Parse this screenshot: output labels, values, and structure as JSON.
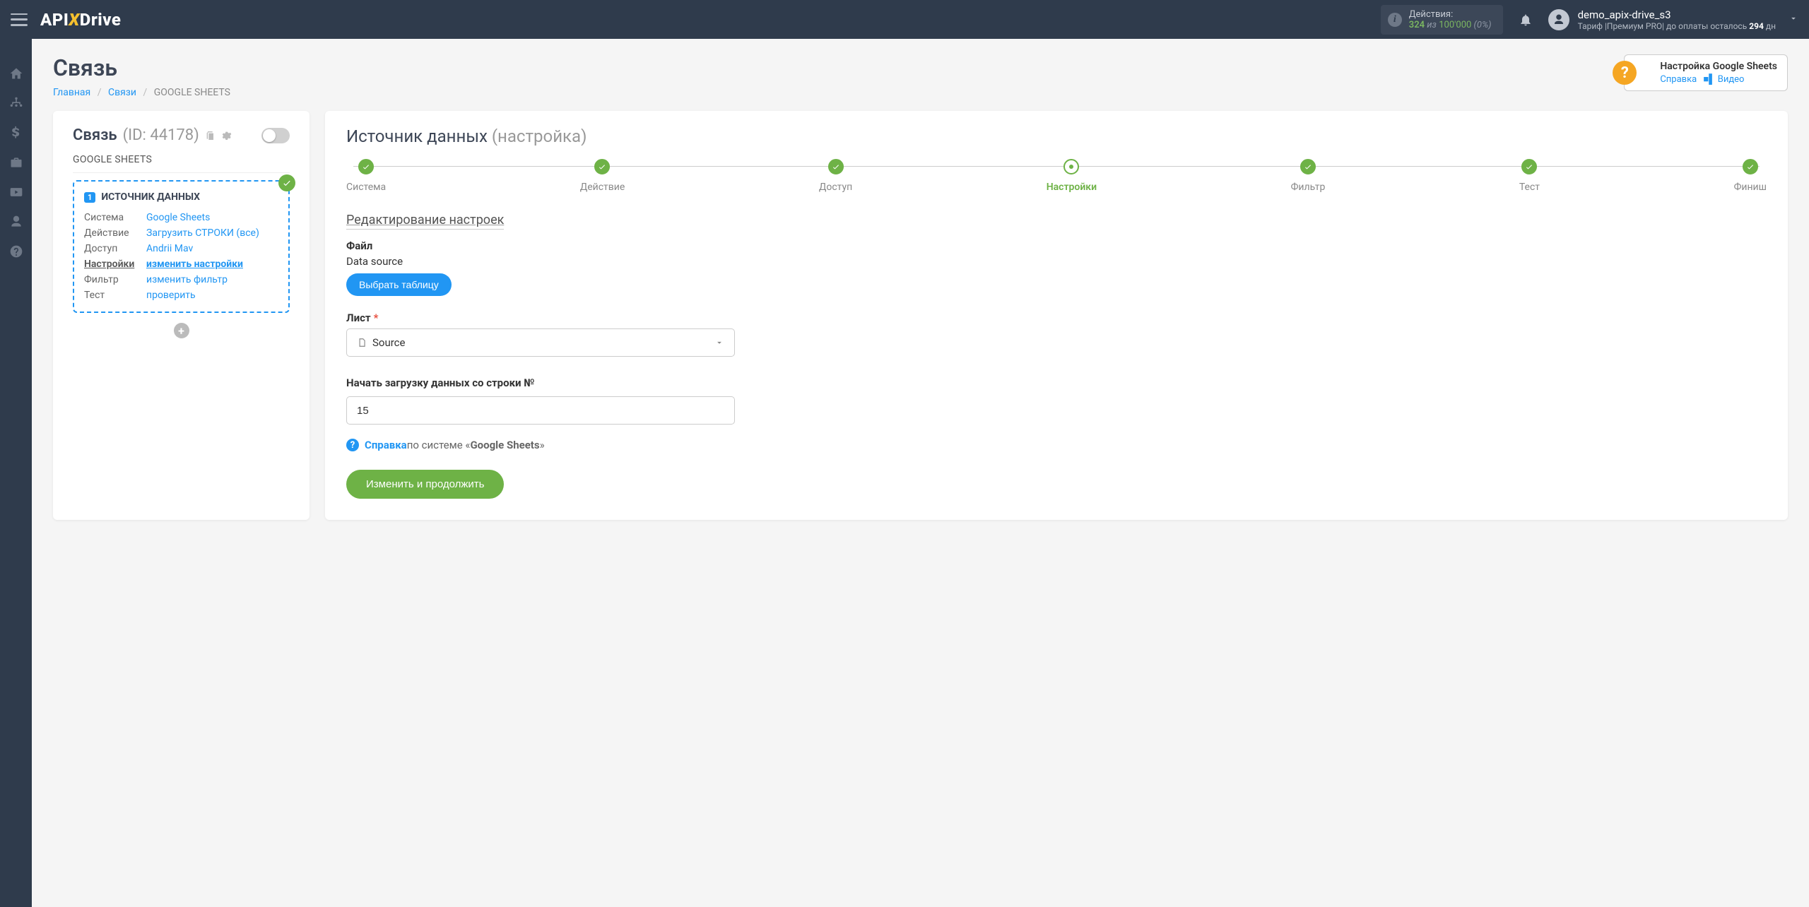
{
  "topbar": {
    "actions_label": "Действия:",
    "actions_count": "324",
    "actions_iz": "из",
    "actions_max": "100'000",
    "actions_pct": "(0%)",
    "username": "demo_apix-drive_s3",
    "tariff_prefix": "Тариф |Премиум PRO| до оплаты осталось ",
    "tariff_days": "294",
    "tariff_suffix": " дн"
  },
  "page": {
    "title": "Связь",
    "breadcrumb_home": "Главная",
    "breadcrumb_links": "Связи",
    "breadcrumb_current": "GOOGLE SHEETS"
  },
  "helpbox": {
    "title": "Настройка Google Sheets",
    "link_help": "Справка",
    "link_video": "Видео"
  },
  "leftcard": {
    "title": "Связь",
    "id": "(ID: 44178)",
    "subtitle": "GOOGLE SHEETS",
    "source_header": "ИСТОЧНИК ДАННЫХ",
    "rows": {
      "system_label": "Система",
      "system_value": "Google Sheets",
      "action_label": "Действие",
      "action_value": "Загрузить СТРОКИ (все)",
      "access_label": "Доступ",
      "access_value": "Andrii Mav",
      "settings_label": "Настройки",
      "settings_value": "изменить настройки",
      "filter_label": "Фильтр",
      "filter_value": "изменить фильтр",
      "test_label": "Тест",
      "test_value": "проверить"
    }
  },
  "rightcard": {
    "title_main": "Источник данных",
    "title_sub": "(настройка)",
    "steps": {
      "s1": "Система",
      "s2": "Действие",
      "s3": "Доступ",
      "s4": "Настройки",
      "s5": "Фильтр",
      "s6": "Тест",
      "s7": "Финиш"
    },
    "section_header": "Редактирование настроек",
    "file_label": "Файл",
    "file_value": "Data source",
    "btn_choose": "Выбрать таблицу",
    "sheet_label": "Лист",
    "sheet_value": "Source",
    "row_label": "Начать загрузку данных со строки №",
    "row_value": "15",
    "help_link": "Справка",
    "help_middle": " по системе «",
    "help_system": "Google Sheets",
    "help_end": "»",
    "btn_continue": "Изменить и продолжить"
  }
}
